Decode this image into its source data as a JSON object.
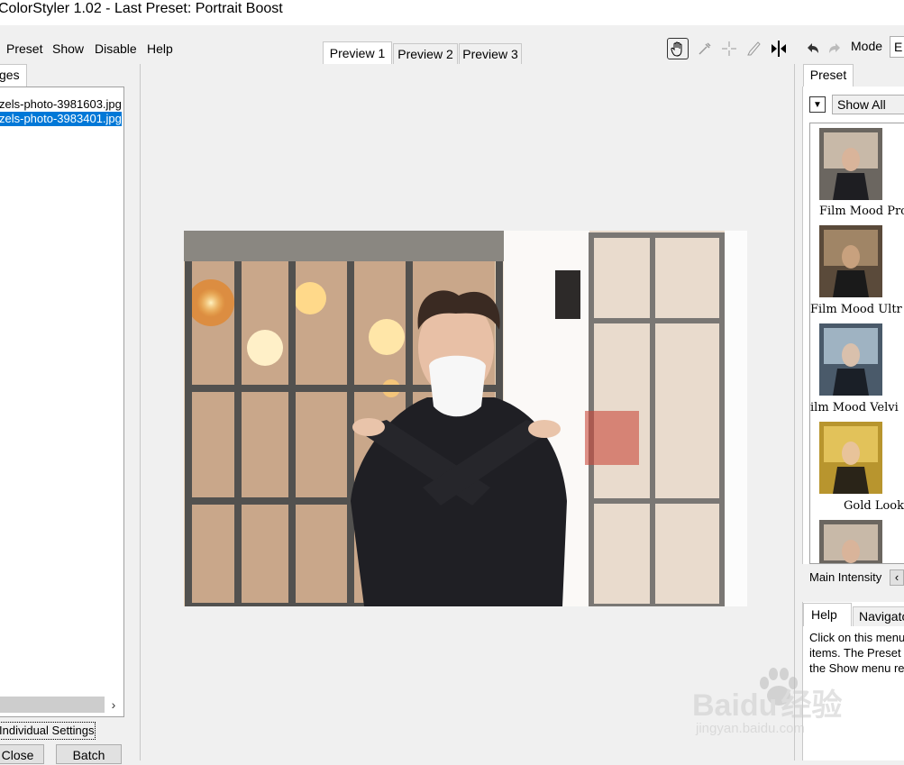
{
  "app": {
    "title": "ColorStyler 1.02 - Last Preset: Portrait Boost"
  },
  "menu": {
    "preset": "Preset",
    "show": "Show",
    "disable": "Disable",
    "help": "Help"
  },
  "preview_tabs": [
    "Preview 1",
    "Preview 2",
    "Preview 3"
  ],
  "toolbar": {
    "mode_label": "Mode",
    "mode_value": "E"
  },
  "left": {
    "tab_label": "ges",
    "files": [
      "zels-photo-3981603.jpg",
      "zels-photo-3983401.jpg"
    ],
    "individual_settings": "Individual Settings",
    "close": "Close",
    "batch": "Batch"
  },
  "right": {
    "preset_tab": "Preset",
    "dropdown_value": "Show All",
    "presets": [
      "Film Mood Pro",
      "Film Mood Ultr",
      "ilm Mood Velvi",
      "Gold Look"
    ],
    "main_intensity": "Main Intensity",
    "help_tab": "Help",
    "navigator_tab": "Navigato",
    "help_text": [
      "Click on this menu",
      "items. The Preset",
      "the Show menu re"
    ]
  },
  "watermark": {
    "brand": "Baidu",
    "cn": "经验",
    "url": "jingyan.baidu.com"
  },
  "colors": {
    "selection": "#0078d7",
    "panel_bg": "#f0f0f0"
  }
}
